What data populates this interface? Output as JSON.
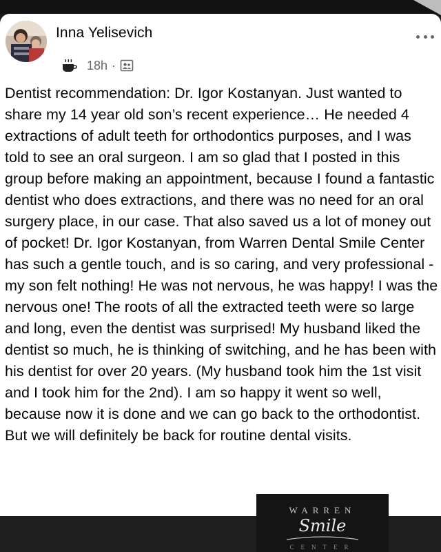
{
  "post": {
    "author": "Inna Yelisevich",
    "time": "18h",
    "separator": "·",
    "audience_icon": "group-audience-icon",
    "status_icon": "coffee-cup-icon",
    "menu_icon": "more-options-icon",
    "body": "Dentist recommendation: Dr. Igor Kostanyan. Just wanted to share my 14 year old son’s recent experience… He needed 4 extractions of adult teeth for orthodontics purposes, and I was told to see an oral surgeon. I am so glad that I posted in this group before making an appointment, because I found a fantastic dentist who does extractions, and there was no need for an oral surgery place, in our case. That also saved us a lot of money out of pocket! Dr. Igor Kostanyan, from Warren Dental Smile Center has such a gentle touch, and is so caring, and very professional - my son felt nothing! He was not nervous, he was happy! I was the nervous one! The roots of all the extracted teeth were so large and long, even the dentist was surprised! My husband liked the dentist so much, he is thinking of switching, and he has been with his dentist for over 20 years. (My husband took him the 1st visit and I took him for the 2nd). I am so happy it went so well, because now it is done and we can go back to the orthodontist. But we will definitely be back for routine dental visits."
  },
  "logo": {
    "line1": "WARREN",
    "line2": "Smile",
    "line3": "CENTER"
  },
  "colors": {
    "text": "#050505",
    "meta": "#65676b",
    "background": "#1b1b1b"
  }
}
